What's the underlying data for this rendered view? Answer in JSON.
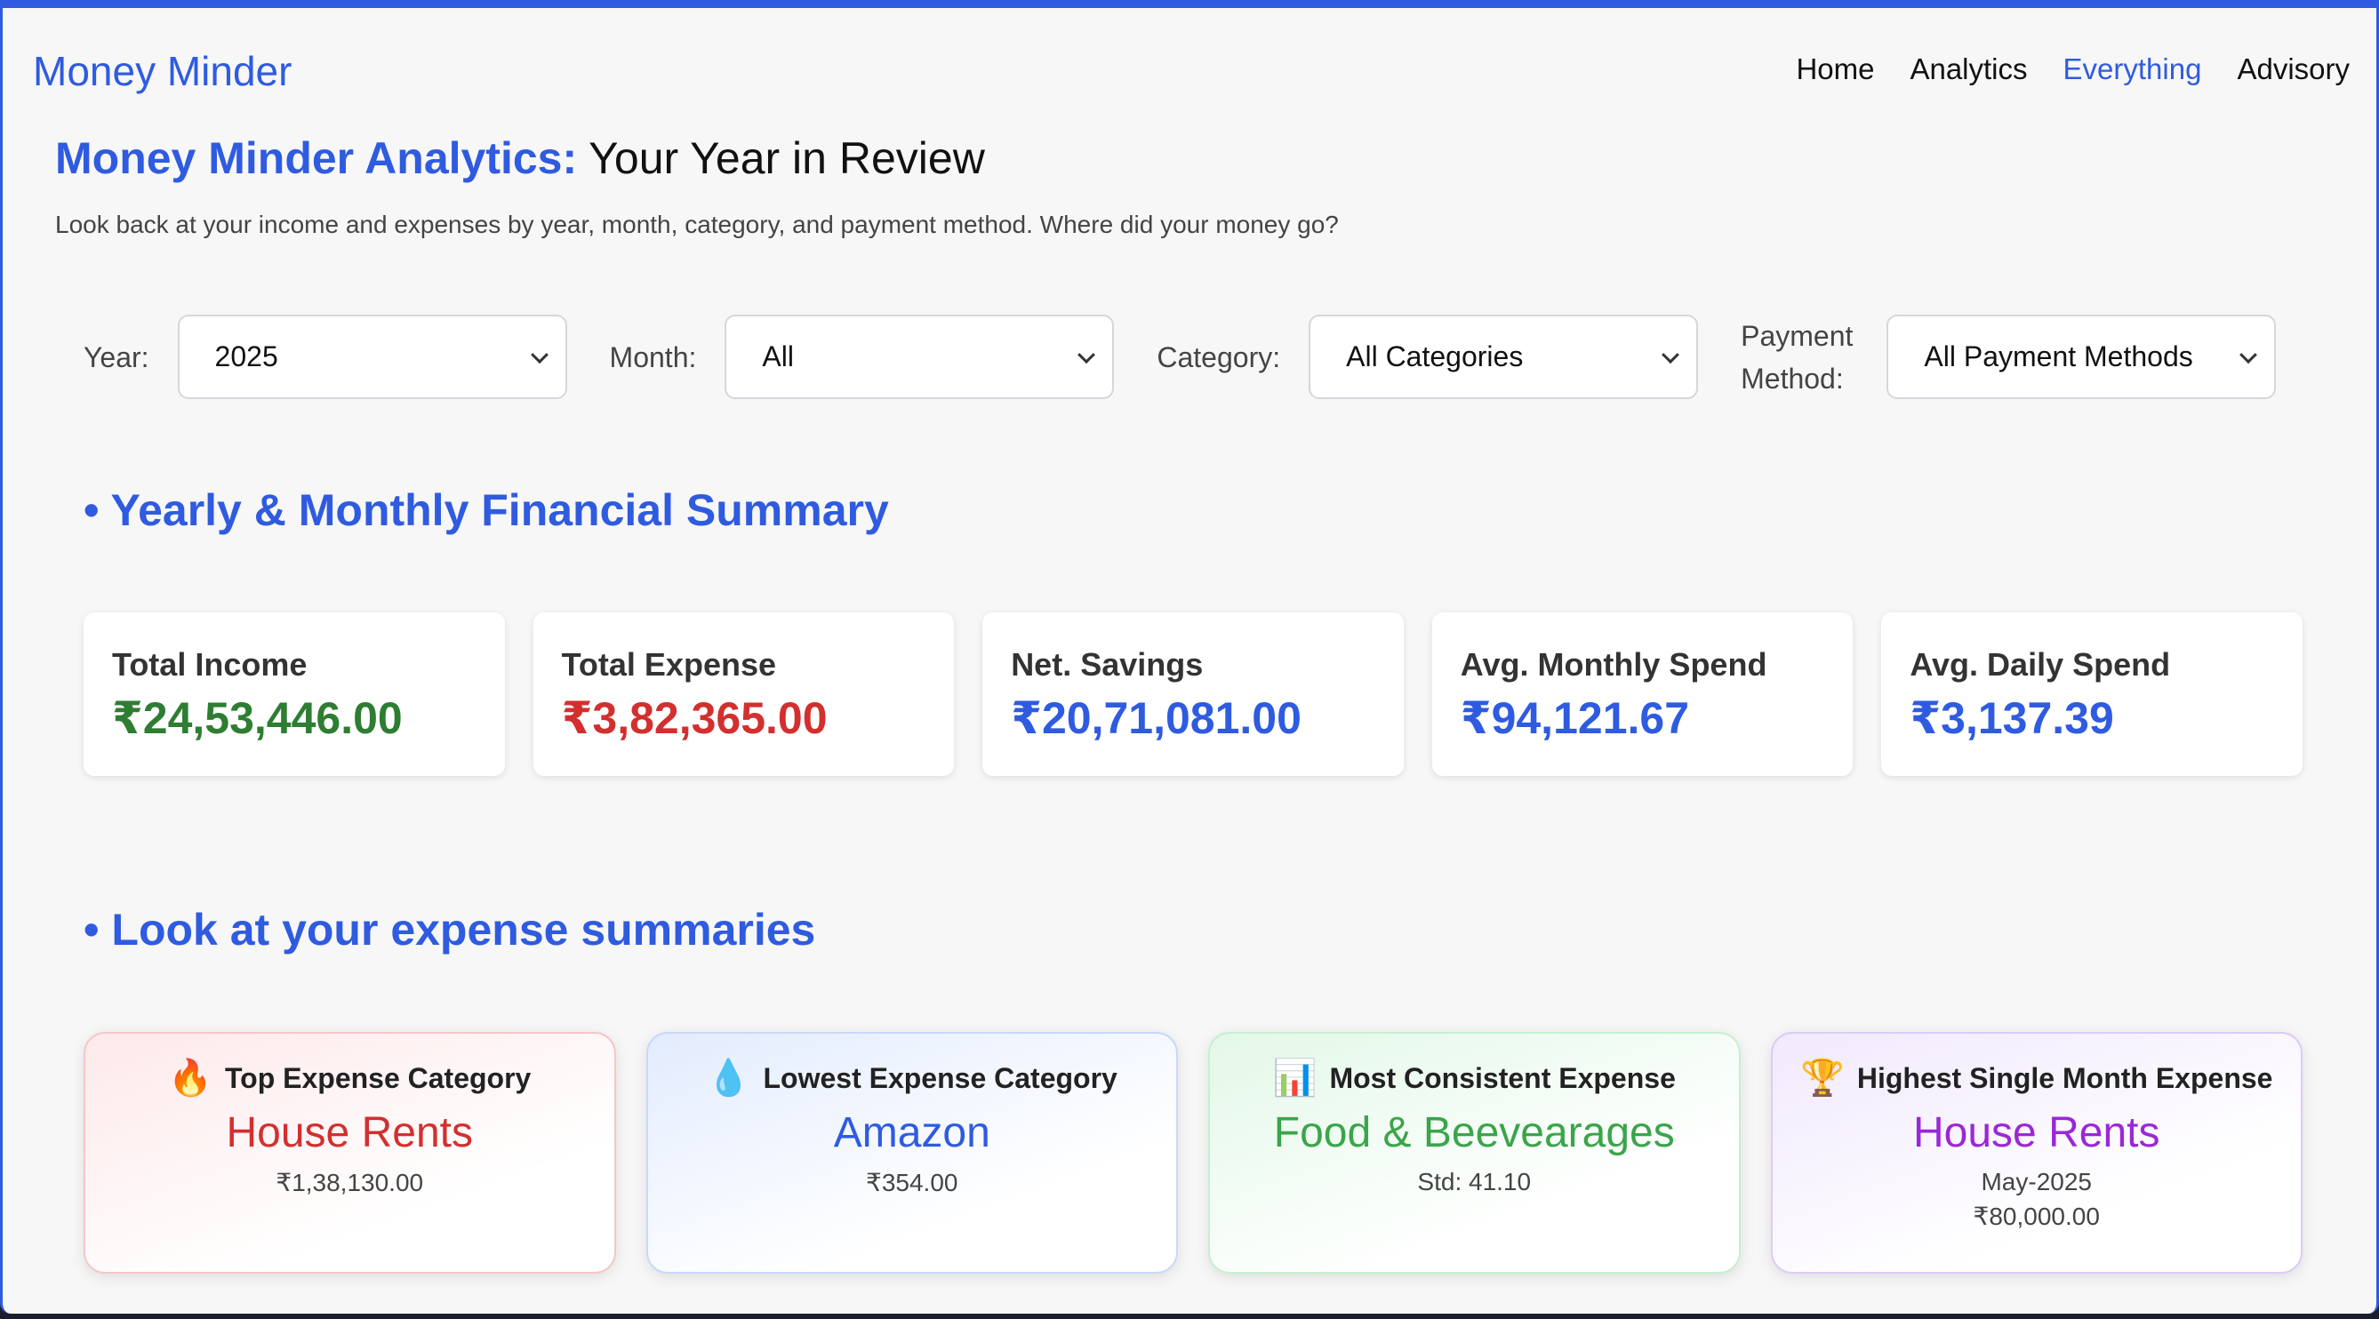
{
  "brand": "Money Minder",
  "nav": [
    "Home",
    "Analytics",
    "Everything",
    "Advisory"
  ],
  "nav_active": "Everything",
  "header": {
    "title_accent": "Money Minder Analytics:",
    "title_rest": " Your Year in Review",
    "subtitle": "Look back at your income and expenses by year, month, category, and payment method. Where did your money go?"
  },
  "filters": {
    "year": {
      "label": "Year:",
      "value": "2025"
    },
    "month": {
      "label": "Month:",
      "value": "All"
    },
    "category": {
      "label": "Category:",
      "value": "All Categories"
    },
    "payment": {
      "label_line1": "Payment",
      "label_line2": "Method:",
      "value": "All Payment Methods"
    }
  },
  "sections": {
    "summary": "• Yearly & Monthly Financial Summary",
    "expenses": "• Look at your expense summaries"
  },
  "summary_cards": [
    {
      "label": "Total Income",
      "value": "₹24,53,446.00",
      "color": "#2e7d32"
    },
    {
      "label": "Total Expense",
      "value": "₹3,82,365.00",
      "color": "#d32f2f"
    },
    {
      "label": "Net. Savings",
      "value": "₹20,71,081.00",
      "color": "#2f5be0"
    },
    {
      "label": "Avg. Monthly Spend",
      "value": "₹94,121.67",
      "color": "#2f5be0"
    },
    {
      "label": "Avg. Daily Spend",
      "value": "₹3,137.39",
      "color": "#2f5be0"
    }
  ],
  "expense_cards": [
    {
      "icon": "🔥",
      "icon_name": "fire-icon",
      "heading": "Top Expense Category",
      "name": "House Rents",
      "detail": "₹1,38,130.00",
      "detail2": "",
      "color": "#d32f2f"
    },
    {
      "icon": "💧",
      "icon_name": "droplet-icon",
      "heading": "Lowest Expense Category",
      "name": "Amazon",
      "detail": "₹354.00",
      "detail2": "",
      "color": "#2f5be0"
    },
    {
      "icon": "📊",
      "icon_name": "bar-chart-icon",
      "heading": "Most Consistent Expense",
      "name": "Food & Beevearages",
      "detail": "Std: 41.10",
      "detail2": "",
      "color": "#3aa54a"
    },
    {
      "icon": "🏆",
      "icon_name": "trophy-icon",
      "heading": "Highest Single Month Expense",
      "name": "House Rents",
      "detail": "May-2025",
      "detail2": "₹80,000.00",
      "color": "#9b27d6"
    }
  ]
}
